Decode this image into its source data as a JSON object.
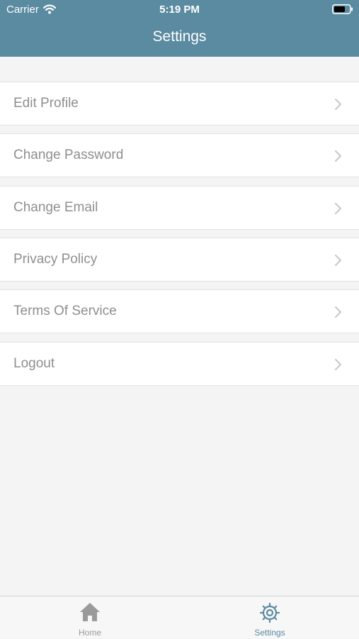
{
  "status_bar": {
    "carrier": "Carrier",
    "time": "5:19 PM",
    "icons": [
      "wifi-icon",
      "battery-icon"
    ]
  },
  "header": {
    "title": "Settings",
    "background_color": "#5b8ba0"
  },
  "menu": {
    "items": [
      {
        "label": "Edit Profile",
        "icon": "chevron-right-icon"
      },
      {
        "label": "Change Password",
        "icon": "chevron-right-icon"
      },
      {
        "label": "Change Email",
        "icon": "chevron-right-icon"
      },
      {
        "label": "Privacy Policy",
        "icon": "chevron-right-icon"
      },
      {
        "label": "Terms Of Service",
        "icon": "chevron-right-icon"
      },
      {
        "label": "Logout",
        "icon": "chevron-right-icon"
      }
    ]
  },
  "tab_bar": {
    "tabs": [
      {
        "label": "Home",
        "icon": "home-icon",
        "selected": false,
        "color": "#9a9a9a"
      },
      {
        "label": "Settings",
        "icon": "gear-icon",
        "selected": true,
        "color": "#5b8ba0"
      }
    ]
  }
}
